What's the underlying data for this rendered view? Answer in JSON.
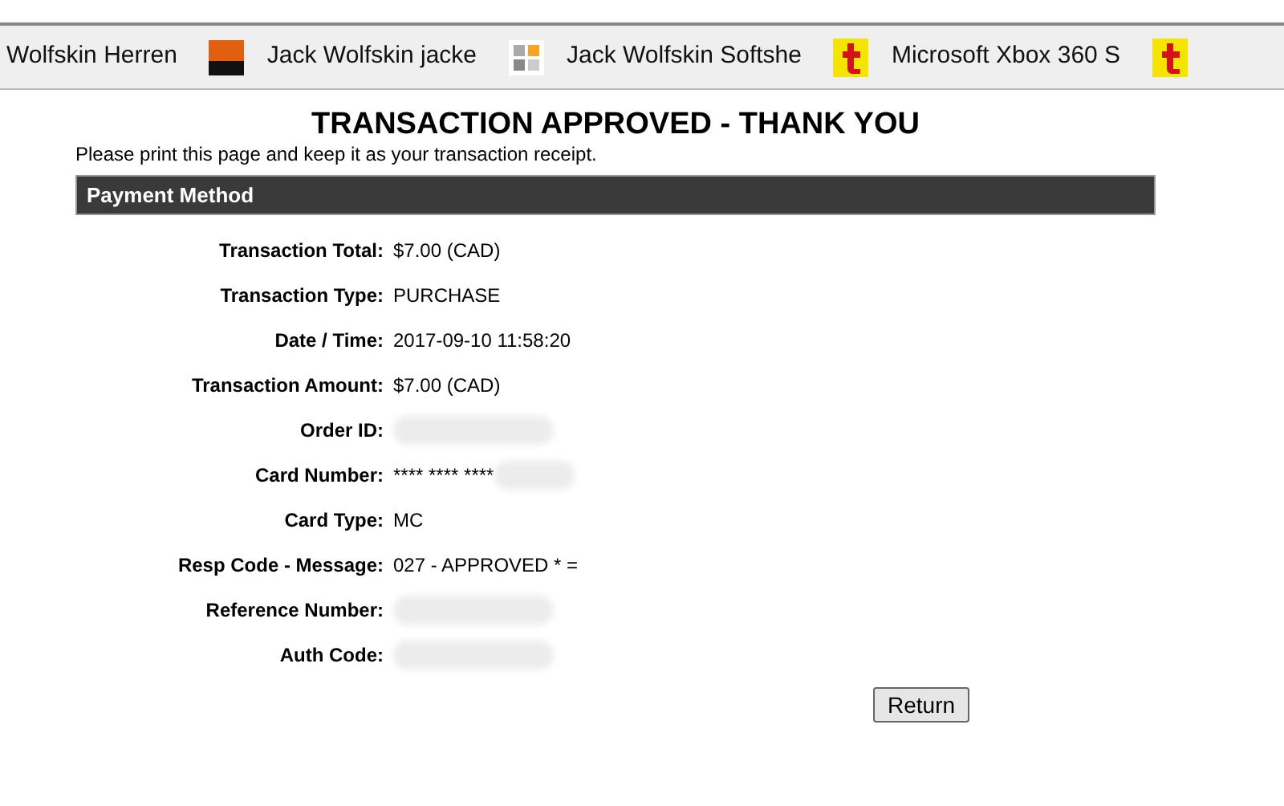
{
  "bookmarks": [
    {
      "label": "Wolfskin Herren",
      "kind": "plain"
    },
    {
      "label": "Jack Wolfskin jacke",
      "kind": "calendar"
    },
    {
      "label": "Jack Wolfskin Softshe",
      "kind": "tiles"
    },
    {
      "label": "Microsoft Xbox 360 S",
      "kind": "letter"
    },
    {
      "kind": "letter"
    }
  ],
  "title": "TRANSACTION APPROVED - THANK YOU",
  "instruction": "Please print this page and keep it as your transaction receipt.",
  "section_header": "Payment Method",
  "fields": [
    {
      "label": "Transaction Total:",
      "kind": "text",
      "value": "$7.00 (CAD)"
    },
    {
      "label": "Transaction Type:",
      "kind": "text",
      "value": "PURCHASE"
    },
    {
      "label": "Date / Time:",
      "kind": "text",
      "value": "2017-09-10 11:58:20"
    },
    {
      "label": "Transaction Amount:",
      "kind": "text",
      "value": "$7.00 (CAD)"
    },
    {
      "label": "Order ID:",
      "kind": "redacted"
    },
    {
      "label": "Card Number:",
      "kind": "partial",
      "value": "**** **** ****"
    },
    {
      "label": "Card Type:",
      "kind": "text",
      "value": "MC"
    },
    {
      "label": "Resp Code - Message:",
      "kind": "text",
      "value": "027 - APPROVED * ="
    },
    {
      "label": "Reference Number:",
      "kind": "redacted"
    },
    {
      "label": "Auth Code:",
      "kind": "redacted"
    }
  ],
  "button": "Return"
}
